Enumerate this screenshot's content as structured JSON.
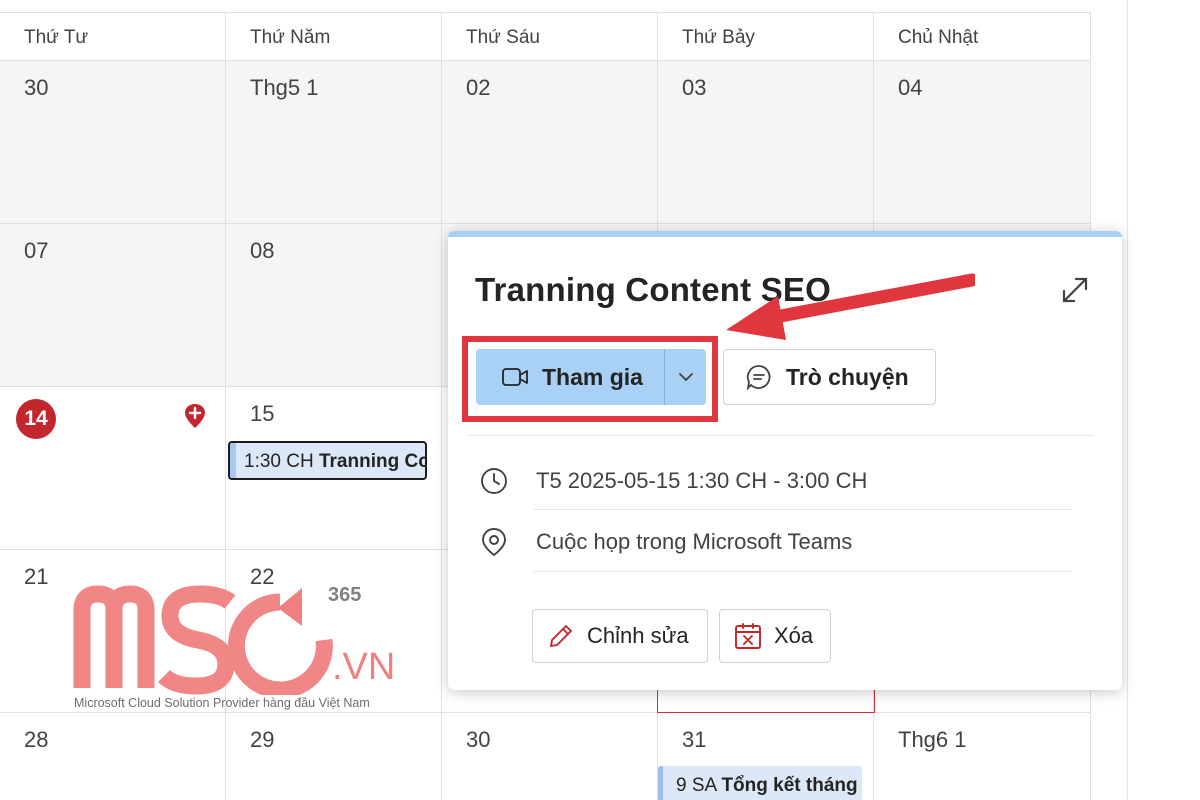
{
  "weekdays": [
    "Thứ Tư",
    "Thứ Năm",
    "Thứ Sáu",
    "Thứ Bảy",
    "Chủ Nhật"
  ],
  "weeks": [
    {
      "days": [
        "30",
        "Thg5 1",
        "02",
        "03",
        "04"
      ]
    },
    {
      "days": [
        "07",
        "08",
        "",
        "",
        ""
      ]
    },
    {
      "days": [
        "14",
        "15",
        "",
        "",
        ""
      ]
    },
    {
      "days": [
        "21",
        "22",
        "",
        "",
        ""
      ]
    },
    {
      "days": [
        "28",
        "29",
        "30",
        "31",
        "Thg6 1"
      ]
    }
  ],
  "events": {
    "chip1_time": "1:30 CH",
    "chip1_title": "Tranning Content SEO",
    "chip2_time": "9 SA",
    "chip2_title": "Tổng kết tháng"
  },
  "popup": {
    "title": "Tranning Content SEO",
    "join_label": "Tham gia",
    "chat_label": "Trò chuyện",
    "datetime": "T5 2025-05-15 1:30 CH - 3:00 CH",
    "location": "Cuộc họp trong Microsoft Teams",
    "edit_label": "Chỉnh sửa",
    "delete_label": "Xóa"
  },
  "watermark": {
    "brand": "MSO",
    "superscript": "365",
    "suffix": ".VN",
    "tagline": "Microsoft Cloud Solution Provider hàng đầu Việt Nam"
  },
  "colors": {
    "accent": "#a9d0f5",
    "today": "#c4262e",
    "annotation": "#e0373f",
    "event_fill": "#dce8f7"
  }
}
